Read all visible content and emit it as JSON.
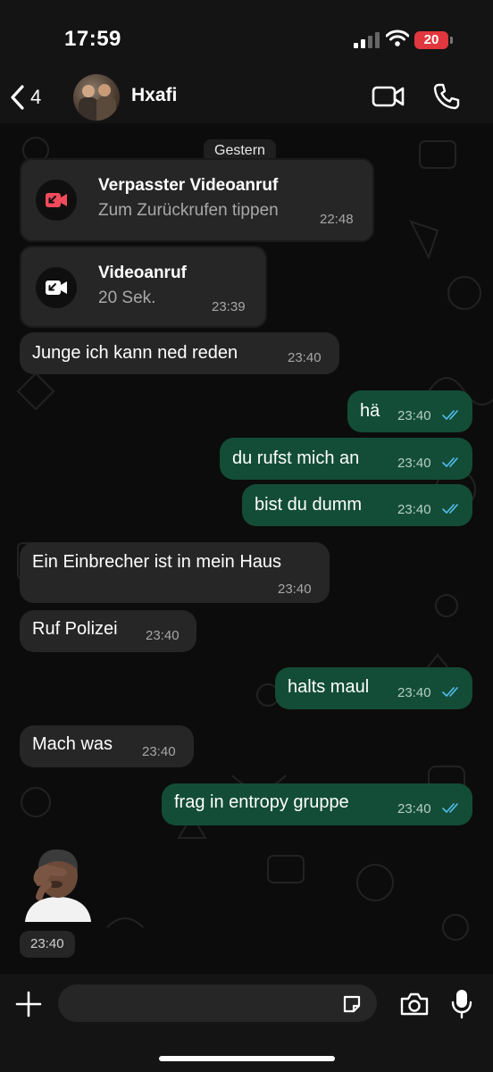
{
  "status_bar": {
    "time": "17:59",
    "battery": "20",
    "battery_color": "#e0383e"
  },
  "header": {
    "back_count": "4",
    "contact_name": "Hxafi",
    "icons": [
      "chevron-left-icon",
      "video-camera-icon",
      "phone-icon"
    ]
  },
  "chat": {
    "date_label": "Gestern",
    "calls": [
      {
        "title": "Verpasster Videoanruf",
        "subtitle": "Zum Zurückrufen tippen",
        "time": "22:48",
        "missed": true,
        "icon_color": "#ef4b5c"
      },
      {
        "title": "Videoanruf",
        "subtitle": "20 Sek.",
        "time": "23:39",
        "missed": false,
        "icon_color": "#ffffff"
      }
    ],
    "messages": [
      {
        "text": "Junge ich kann ned reden",
        "time": "23:40",
        "direction": "in"
      },
      {
        "text": "hä",
        "time": "23:40",
        "direction": "out",
        "read": true
      },
      {
        "text": "du rufst mich an",
        "time": "23:40",
        "direction": "out",
        "read": true
      },
      {
        "text": "bist du dumm",
        "time": "23:40",
        "direction": "out",
        "read": true
      },
      {
        "text": "Ein Einbrecher ist in mein Haus",
        "time": "23:40",
        "direction": "in"
      },
      {
        "text": "Ruf Polizei",
        "time": "23:40",
        "direction": "in"
      },
      {
        "text": "halts maul",
        "time": "23:40",
        "direction": "out",
        "read": true
      },
      {
        "text": "Mach was",
        "time": "23:40",
        "direction": "in"
      },
      {
        "text": "frag in entropy gruppe",
        "time": "23:40",
        "direction": "out",
        "read": true
      }
    ],
    "sticker": {
      "emoji": "person-facepalming-emoji",
      "time": "23:40"
    }
  },
  "input_bar": {
    "placeholder": "",
    "icons": [
      "plus-icon",
      "sticker-icon",
      "camera-icon",
      "microphone-icon"
    ]
  },
  "colors": {
    "incoming_bubble": "#262626",
    "outgoing_bubble": "#134d37",
    "read_ticks": "#53bdeb",
    "background": "#0c0c0c"
  }
}
